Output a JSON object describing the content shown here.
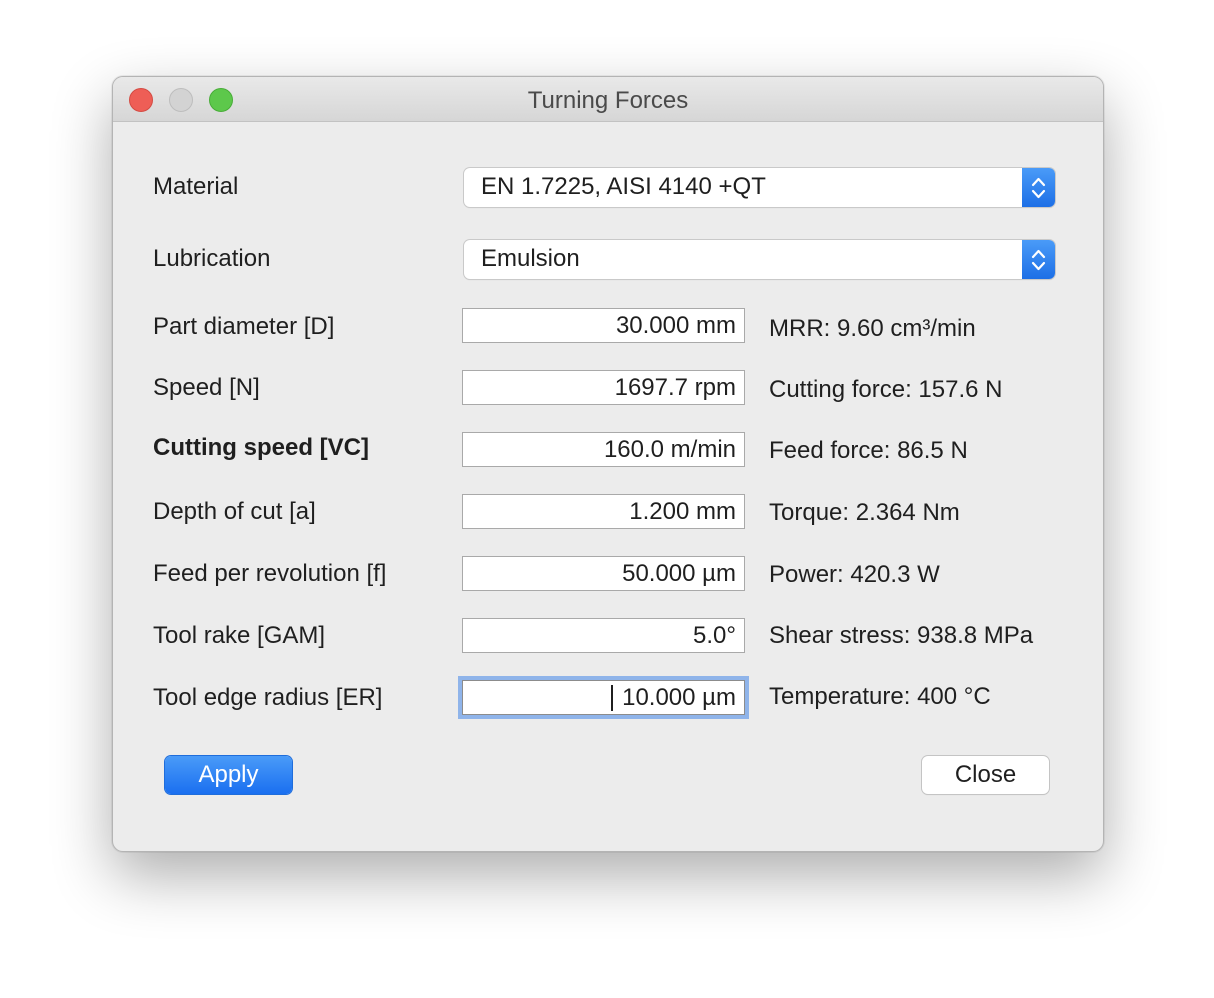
{
  "window": {
    "title": "Turning Forces"
  },
  "material": {
    "label": "Material",
    "selected": "EN 1.7225, AISI 4140 +QT"
  },
  "lubrication": {
    "label": "Lubrication",
    "selected": "Emulsion"
  },
  "inputs": [
    {
      "label": "Part diameter [D]",
      "value": "30.000 mm",
      "bold": false,
      "focused": false
    },
    {
      "label": "Speed [N]",
      "value": "1697.7 rpm",
      "bold": false,
      "focused": false
    },
    {
      "label": "Cutting speed [VC]",
      "value": "160.0 m/min",
      "bold": true,
      "focused": false
    },
    {
      "label": "Depth of cut [a]",
      "value": "1.200 mm",
      "bold": false,
      "focused": false
    },
    {
      "label": "Feed per revolution [f]",
      "value": "50.000 µm",
      "bold": false,
      "focused": false
    },
    {
      "label": "Tool rake [GAM]",
      "value": "5.0°",
      "bold": false,
      "focused": false
    },
    {
      "label": "Tool edge radius [ER]",
      "value": "10.000 µm",
      "bold": false,
      "focused": true
    }
  ],
  "results": [
    "MRR: 9.60 cm³/min",
    "Cutting force: 157.6 N",
    "Feed force: 86.5 N",
    "Torque: 2.364 Nm",
    "Power: 420.3 W",
    "Shear stress: 938.8 MPa",
    "Temperature: 400 °C"
  ],
  "buttons": {
    "apply": "Apply",
    "close": "Close"
  },
  "colors": {
    "accent": "#1d6fe6",
    "window_background": "#ececec",
    "focus_ring": "#8fb4ea",
    "close_light": "#ee5e56",
    "zoom_light": "#5dc84b"
  }
}
